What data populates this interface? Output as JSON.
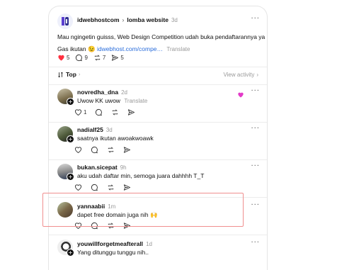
{
  "post": {
    "author": "idwebhostcom",
    "separator": "›",
    "community": "lomba website",
    "time": "3d",
    "body_line1": "Mau ngingetin guisss, Web Design Competition udah buka pendaftarannya ya 🙌",
    "body_line2_prefix": "Gas ikutan 😉",
    "link_text": "idwebhost.com/compe…",
    "translate": "Translate",
    "likes": "5",
    "replies": "9",
    "reposts": "7",
    "shares": "5"
  },
  "sort": {
    "label": "Top",
    "view_activity": "View activity"
  },
  "replies": [
    {
      "author": "novredha_dna",
      "time": "2d",
      "text": "Uwow KK uwow",
      "translate": "Translate",
      "likes": "1"
    },
    {
      "author": "nadialf25",
      "time": "3d",
      "text": "saatnya ikutan awoakwoawk"
    },
    {
      "author": "bukan.sicepat",
      "time": "9h",
      "text": "aku udah daftar min, semoga juara dahhhh T_T"
    },
    {
      "author": "yannaabii",
      "time": "1m",
      "text": "dapet free domain juga nih 🙌"
    },
    {
      "author": "youwillforgetmeafterall",
      "time": "1d",
      "text": "Yang ditunggu tunggu nih.."
    }
  ],
  "colors": {
    "like_active": "#ff3040",
    "link": "#2a6ddb",
    "highlight_border": "#f08f8f"
  },
  "icons": [
    "heart-icon",
    "comment-icon",
    "repost-icon",
    "share-icon",
    "more-icon",
    "sort-icon",
    "chevron-right-icon",
    "plus-icon"
  ]
}
